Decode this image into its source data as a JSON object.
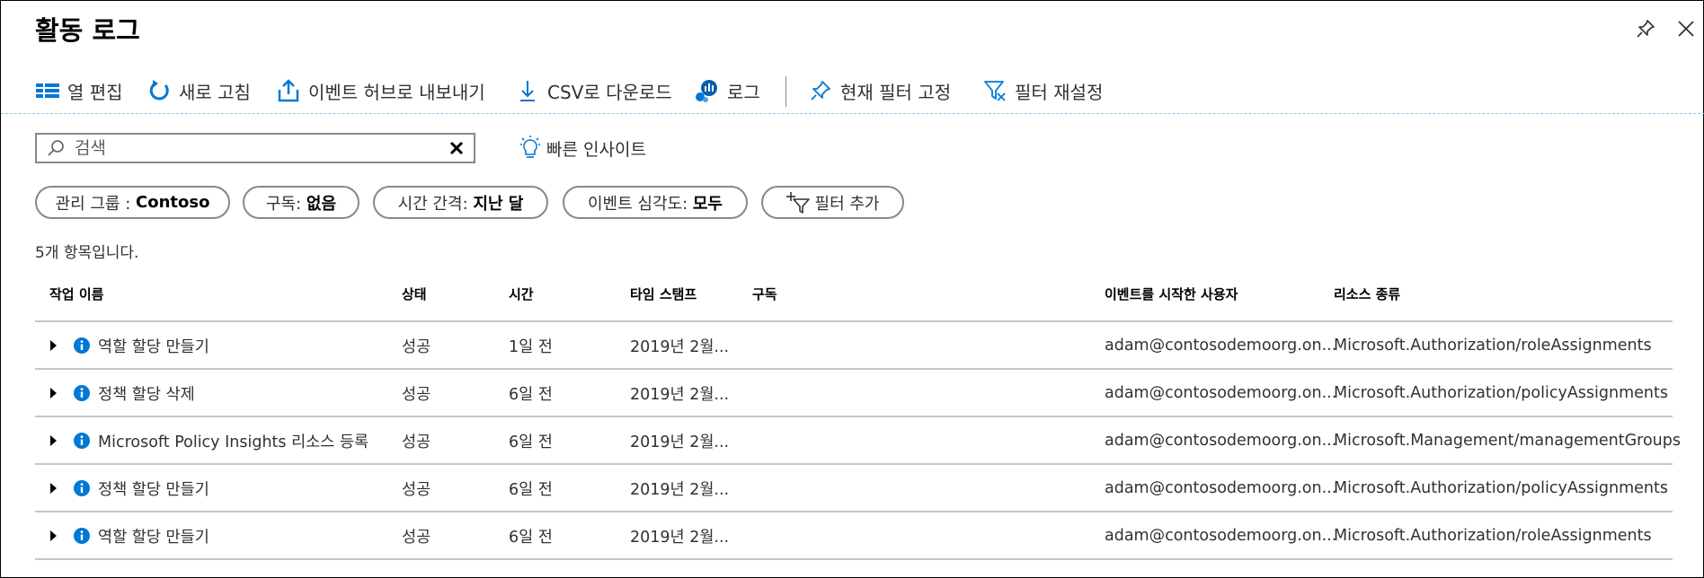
{
  "header": {
    "title": "활동 로그"
  },
  "toolbar": {
    "edit_columns": "열 편집",
    "refresh": "새로 고침",
    "export_event_hub": "이벤트 허브로 내보내기",
    "download_csv": "CSV로 다운로드",
    "logs": "로그",
    "pin_filters": "현재 필터 고정",
    "reset_filters": "필터 재설정"
  },
  "search": {
    "placeholder": "검색",
    "value": ""
  },
  "quick_insights": "빠른 인사이트",
  "filters": {
    "management_group": {
      "label": "관리 그룹 : ",
      "value": "Contoso"
    },
    "subscription": {
      "label": "구독: ",
      "value": "없음"
    },
    "timespan": {
      "label": "시간 간격: ",
      "value": "지난 달"
    },
    "severity": {
      "label": "이벤트 심각도: ",
      "value": "모두"
    },
    "add_filter": "필터 추가"
  },
  "item_count": "5개 항목입니다.",
  "table": {
    "headers": {
      "operation": "작업 이름",
      "status": "상태",
      "time": "시간",
      "timestamp": "타임 스탬프",
      "subscription": "구독",
      "initiated_by": "이벤트를 시작한 사용자",
      "resource_type": "리소스 종류"
    },
    "rows": [
      {
        "operation": "역할 할당 만들기",
        "status": "성공",
        "time": "1일 전",
        "timestamp": "2019년 2월...",
        "subscription": "",
        "initiated_by": "adam@contosodemoorg.on...",
        "resource_type": "Microsoft.Authorization/roleAssignments"
      },
      {
        "operation": "정책 할당 삭제",
        "status": "성공",
        "time": "6일 전",
        "timestamp": "2019년 2월...",
        "subscription": "",
        "initiated_by": "adam@contosodemoorg.on...",
        "resource_type": "Microsoft.Authorization/policyAssignments"
      },
      {
        "operation": "Microsoft Policy Insights 리소스 등록",
        "status": "성공",
        "time": "6일 전",
        "timestamp": "2019년 2월...",
        "subscription": "",
        "initiated_by": "adam@contosodemoorg.on...",
        "resource_type": "Microsoft.Management/managementGroups"
      },
      {
        "operation": "정책 할당 만들기",
        "status": "성공",
        "time": "6일 전",
        "timestamp": "2019년 2월...",
        "subscription": "",
        "initiated_by": "adam@contosodemoorg.on...",
        "resource_type": "Microsoft.Authorization/policyAssignments"
      },
      {
        "operation": "역할 할당 만들기",
        "status": "성공",
        "time": "6일 전",
        "timestamp": "2019년 2월...",
        "subscription": "",
        "initiated_by": "adam@contosodemoorg.on...",
        "resource_type": "Microsoft.Authorization/roleAssignments"
      }
    ]
  },
  "colors": {
    "accent": "#0078d4",
    "border": "#8a8886",
    "divider": "#c8c6c4"
  }
}
